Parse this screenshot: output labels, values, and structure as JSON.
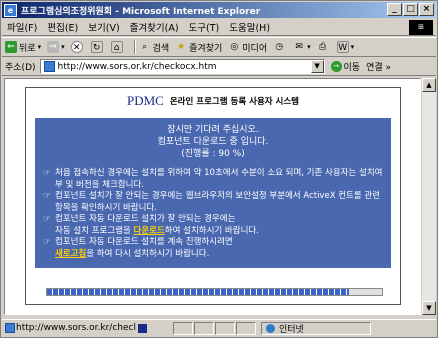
{
  "window": {
    "title": "프로그램심의조정위원회 - Microsoft Internet Explorer",
    "buttons": {
      "minimize": "_",
      "maximize": "□",
      "close": "×"
    }
  },
  "menu": [
    "파일(F)",
    "편집(E)",
    "보기(V)",
    "즐겨찾기(A)",
    "도구(T)",
    "도움말(H)"
  ],
  "toolbar": {
    "back": "뒤로",
    "search": "검색",
    "favorites": "즐겨찾기",
    "media": "미디어"
  },
  "address": {
    "label": "주소(D)",
    "url": "http://www.sors.or.kr/checkocx.htm",
    "go": "이동",
    "links": "연결 »"
  },
  "page": {
    "brand": "PDMC",
    "subtitle": "온라인 프로그램 등록 사용자 시스템",
    "wait_lines": [
      "잠시만 기다려 주십시오.",
      "컴포넌트 다운로드 중 입니다.",
      "(진행률 : 90 %)"
    ],
    "notes": {
      "n1": "처음 접속하신 경우에는 설치를 위하여 약 10초에서 수분이 소요 되며, 기존 사용자는 설치여부 및 버전을 체크합니다.",
      "n2": "컴포넌트 설치가 잘 안되는 경우에는 웹브라우저의 보안설정 부분에서 ActiveX 컨트롤 관련 항목을 확인하시기 바랍니다.",
      "n3_a": "컴포넌트 자동 다운로드 설치가 잘 안되는 경우에는",
      "n3_b": "자동 설치 프로그램을 ",
      "n3_link": "다운로드",
      "n3_c": "하여 설치하시기 바랍니다.",
      "n4_a": "컴포넌트 자동 다운로드 설치를 계속 진행하시려면",
      "n4_link": "새로고침",
      "n4_b": "을 하여 다시 설치하시기 바랍니다."
    },
    "bullet": "☞",
    "progress_fraction": 0.9
  },
  "status": {
    "text": "http://www.sors.or.kr/checl",
    "zone": "인터넷"
  }
}
